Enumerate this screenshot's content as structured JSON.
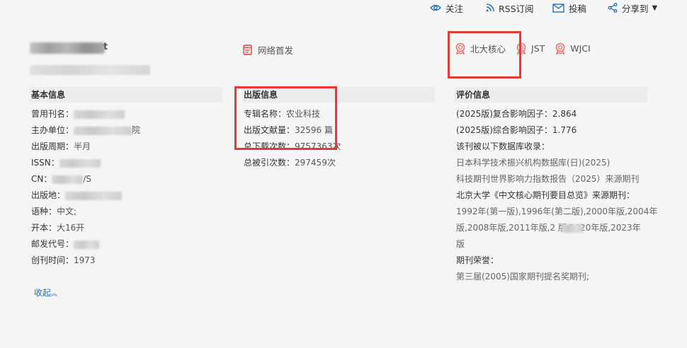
{
  "toolbar": {
    "follow_label": "关注",
    "rss_label": "RSS订阅",
    "submit_label": "投稿",
    "share_label": "分享到"
  },
  "journal": {
    "title_tail": "t",
    "first_publish_label": "网络首发"
  },
  "badges": [
    "北大核心",
    "JST",
    "WJCI"
  ],
  "basic_info": {
    "title": "基本信息",
    "rows": [
      {
        "label": "曾用刊名：",
        "value": ""
      },
      {
        "label": "主办单位：",
        "value": "院"
      },
      {
        "label": "出版周期：",
        "value": "半月"
      },
      {
        "label": "ISSN：",
        "value": ""
      },
      {
        "label": "CN：",
        "value": "/S"
      },
      {
        "label": "出版地：",
        "value": ""
      },
      {
        "label": "语种：",
        "value": "中文;"
      },
      {
        "label": "开本：",
        "value": "大16开"
      },
      {
        "label": "邮发代号：",
        "value": ""
      },
      {
        "label": "创刊时间：",
        "value": "1973"
      }
    ],
    "collapse_label": "收起"
  },
  "publish_info": {
    "title": "出版信息",
    "rows": [
      {
        "label": "专辑名称：",
        "value": "农业科技"
      },
      {
        "label": "出版文献量：",
        "value": "32596 篇"
      },
      {
        "label": "总下载次数：",
        "value": "9757363次"
      },
      {
        "label": "总被引次数：",
        "value": "297459次"
      }
    ]
  },
  "evaluation_info": {
    "title": "评价信息",
    "lines": [
      "(2025版)复合影响因子：2.864",
      "(2025版)综合影响因子：1.776",
      "该刊被以下数据库收录：",
      "日本科学技术振兴机构数据库(日)(2025)",
      "科技期刊世界影响力指数报告（2025）来源期刊",
      "北京大学《中文核心期刊要目总览》来源期刊：",
      "1992年(第一版),1996年(第二版),2000年版,2004年",
      "版,2008年版,2011年版,2   版,2020年版,2023年",
      "版",
      "期刊荣誉：",
      "第三届(2005)国家期刊提名奖期刊;"
    ]
  },
  "colors": {
    "link": "#2a6fb8",
    "badge": "#e57373",
    "highlight": "#e53935",
    "section_bg": "#ececec"
  }
}
